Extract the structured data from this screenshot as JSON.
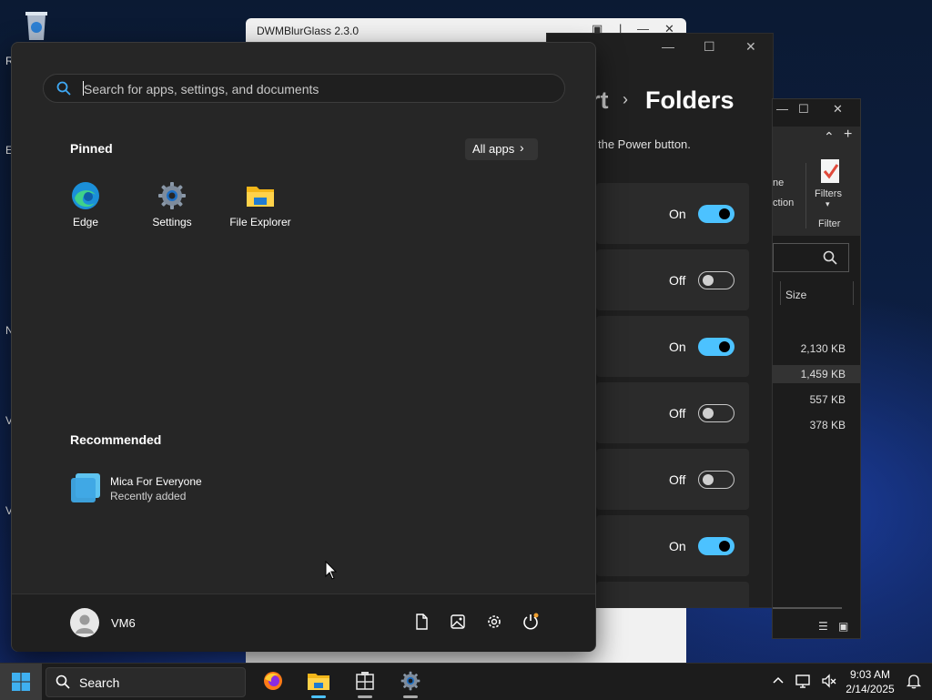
{
  "desktop": {
    "letters": [
      "R",
      "E",
      "N",
      "V",
      "V"
    ]
  },
  "dwm_window": {
    "title": "DWMBlurGlass 2.3.0"
  },
  "settings_window": {
    "breadcrumb_prev": "rt",
    "breadcrumb_current": "Folders",
    "power_text": "the Power button.",
    "toggles": [
      {
        "state": "On",
        "on": true
      },
      {
        "state": "Off",
        "on": false
      },
      {
        "state": "On",
        "on": true
      },
      {
        "state": "Off",
        "on": false
      },
      {
        "state": "Off",
        "on": false
      },
      {
        "state": "On",
        "on": true
      }
    ]
  },
  "explorer_window": {
    "ribbon_partial_1": "ne",
    "ribbon_partial_2": "ction",
    "filters_label": "Filters",
    "filter_group_label": "Filter",
    "size_header": "Size",
    "sizes": [
      "2,130 KB",
      "1,459 KB",
      "557 KB",
      "378 KB"
    ]
  },
  "start_menu": {
    "search_placeholder": "Search for apps, settings, and documents",
    "pinned_title": "Pinned",
    "all_apps_label": "All apps",
    "pinned_apps": [
      {
        "label": "Edge",
        "icon": "edge-icon"
      },
      {
        "label": "Settings",
        "icon": "settings-gear-icon"
      },
      {
        "label": "File Explorer",
        "icon": "folder-icon"
      }
    ],
    "recommended_title": "Recommended",
    "recommended": [
      {
        "name": "Mica For Everyone",
        "subtitle": "Recently added",
        "icon": "mica-app-icon"
      }
    ],
    "user_name": "VM6"
  },
  "taskbar": {
    "search_label": "Search",
    "time": "9:03 AM",
    "date": "2/14/2025"
  },
  "colors": {
    "accent": "#4cc2ff",
    "start_bg": "#262626",
    "taskbar_bg": "#1c1c1c"
  }
}
